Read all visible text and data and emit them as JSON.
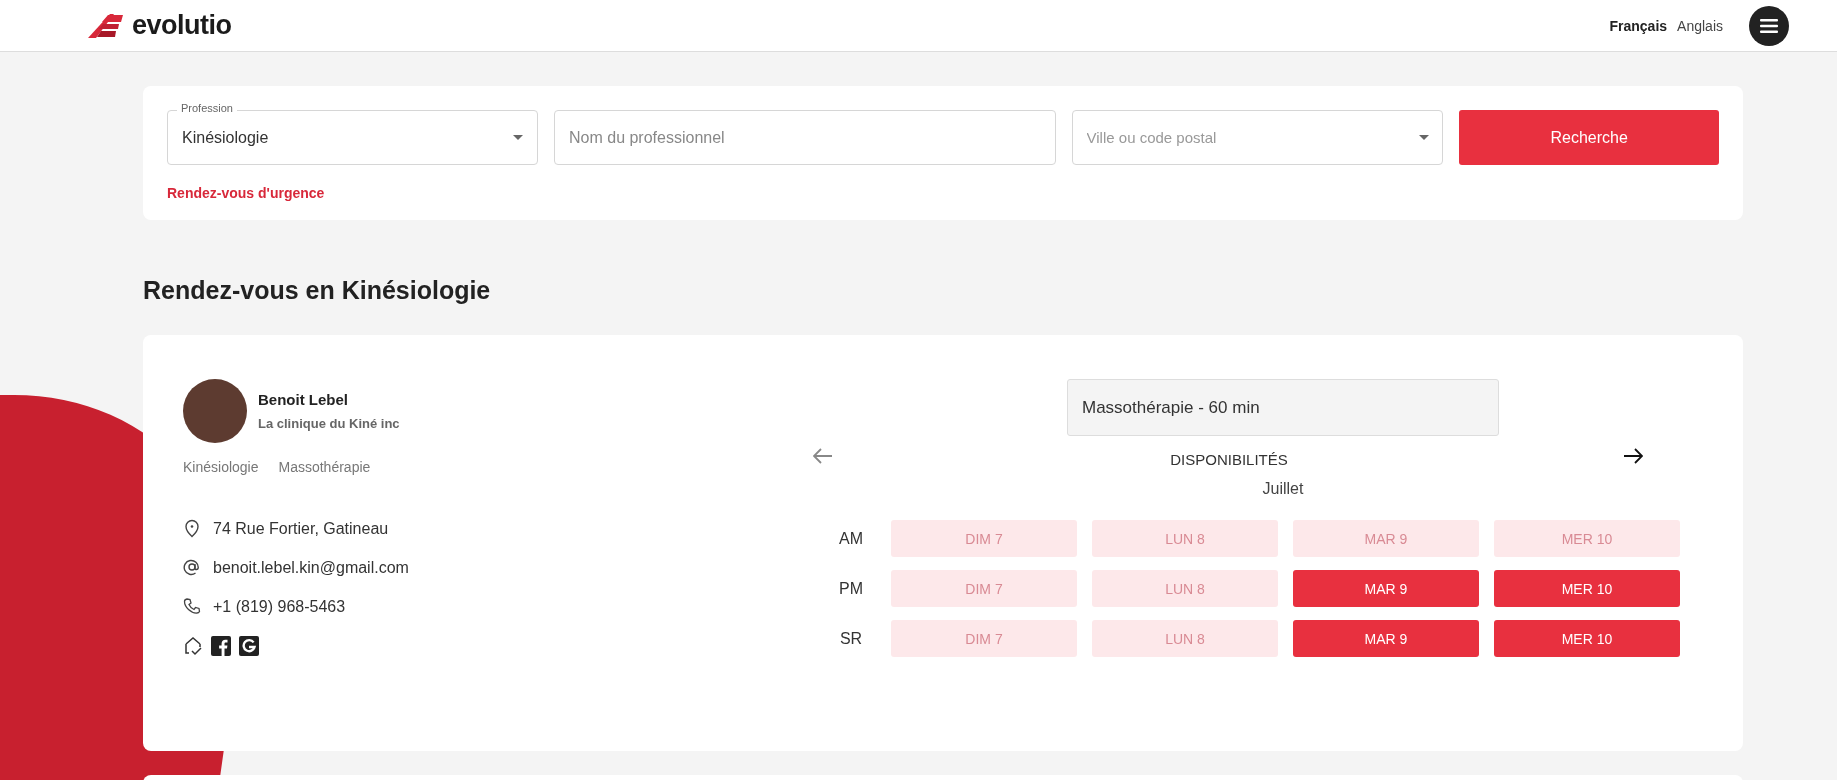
{
  "header": {
    "logo": "evolutio",
    "languages": [
      {
        "label": "Français",
        "selected": true
      },
      {
        "label": "Anglais",
        "selected": false
      }
    ]
  },
  "search": {
    "profession": {
      "label": "Profession",
      "value": "Kinésiologie"
    },
    "name_field": {
      "placeholder": "Nom du professionnel"
    },
    "city_field": {
      "placeholder": "Ville ou code postal"
    },
    "button": "Recherche",
    "urgent_link": "Rendez-vous d'urgence"
  },
  "heading": "Rendez-vous en Kinésiologie",
  "provider": {
    "name": "Benoit Lebel",
    "clinic": "La clinique du Kiné inc",
    "tags": [
      "Kinésiologie",
      "Massothérapie"
    ],
    "contacts": [
      {
        "kind": "address",
        "text": "74 Rue Fortier, Gatineau"
      },
      {
        "kind": "email",
        "text": "benoit.lebel.kin@gmail.com"
      },
      {
        "kind": "phone",
        "text": "+1 (819) 968-5463"
      }
    ],
    "links": [
      {
        "kind": "website"
      },
      {
        "kind": "facebook"
      },
      {
        "kind": "google"
      }
    ]
  },
  "availability": {
    "service": "Massothérapie - 60 min",
    "title": "DISPONIBILITÉS",
    "month": "Juillet",
    "prev": {
      "disabled": true
    },
    "next": {
      "disabled": false
    },
    "rows": [
      {
        "period": "AM",
        "slots": [
          {
            "label": "DIM 7",
            "available": false
          },
          {
            "label": "LUN 8",
            "available": false
          },
          {
            "label": "MAR 9",
            "available": false
          },
          {
            "label": "MER 10",
            "available": false
          }
        ]
      },
      {
        "period": "PM",
        "slots": [
          {
            "label": "DIM 7",
            "available": false
          },
          {
            "label": "LUN 8",
            "available": false
          },
          {
            "label": "MAR 9",
            "available": true
          },
          {
            "label": "MER 10",
            "available": true
          }
        ]
      },
      {
        "period": "SR",
        "slots": [
          {
            "label": "DIM 7",
            "available": false
          },
          {
            "label": "LUN 8",
            "available": false
          },
          {
            "label": "MAR 9",
            "available": true
          },
          {
            "label": "MER 10",
            "available": true
          }
        ]
      }
    ]
  }
}
